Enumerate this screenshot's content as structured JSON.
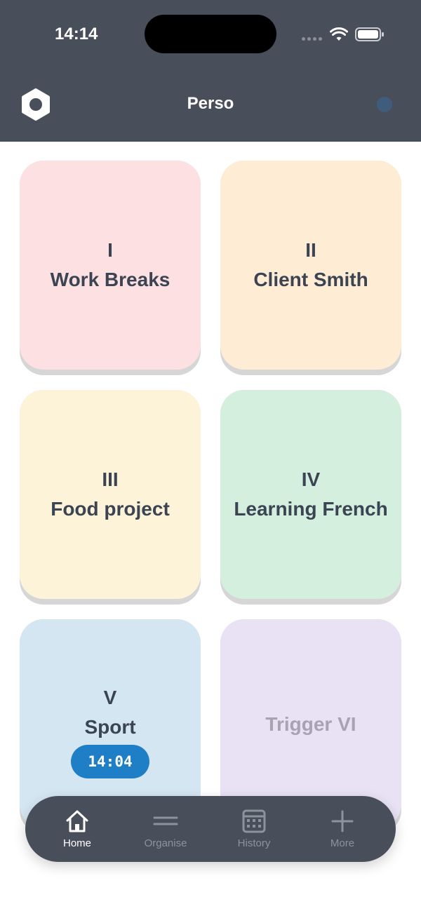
{
  "status_bar": {
    "time": "14:14"
  },
  "header": {
    "title": "Perso"
  },
  "tiles": [
    {
      "numeral": "I",
      "name": "Work Breaks",
      "color": "#fde0e2"
    },
    {
      "numeral": "II",
      "name": "Client Smith",
      "color": "#feecd5"
    },
    {
      "numeral": "III",
      "name": "Food project",
      "color": "#fdf3d8"
    },
    {
      "numeral": "IV",
      "name": "Learning French",
      "color": "#d5efdf"
    },
    {
      "numeral": "V",
      "name": "Sport",
      "color": "#d5e6f3",
      "timer": "14:04"
    },
    {
      "numeral": "",
      "name": "Trigger VI",
      "color": "#e8e2f4"
    }
  ],
  "tabbar": {
    "tabs": [
      {
        "label": "Home",
        "icon": "home-icon",
        "active": true
      },
      {
        "label": "Organise",
        "icon": "menu-lines-icon",
        "active": false
      },
      {
        "label": "History",
        "icon": "calendar-icon",
        "active": false
      },
      {
        "label": "More",
        "icon": "plus-icon",
        "active": false
      }
    ]
  },
  "colors": {
    "header_bg": "#484f5a",
    "timer_badge": "#1f7fc6",
    "text_dark": "#3b4452"
  }
}
